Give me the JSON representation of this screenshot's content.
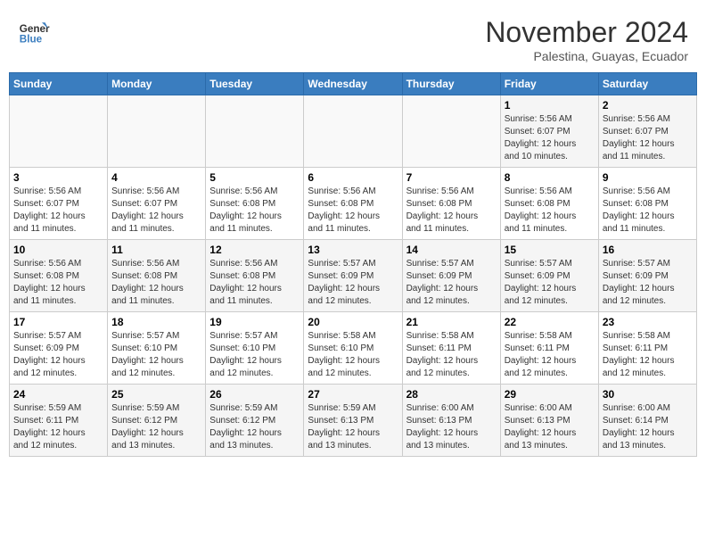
{
  "header": {
    "logo_line1": "General",
    "logo_line2": "Blue",
    "month": "November 2024",
    "location": "Palestina, Guayas, Ecuador"
  },
  "weekdays": [
    "Sunday",
    "Monday",
    "Tuesday",
    "Wednesday",
    "Thursday",
    "Friday",
    "Saturday"
  ],
  "weeks": [
    [
      {
        "day": "",
        "info": ""
      },
      {
        "day": "",
        "info": ""
      },
      {
        "day": "",
        "info": ""
      },
      {
        "day": "",
        "info": ""
      },
      {
        "day": "",
        "info": ""
      },
      {
        "day": "1",
        "info": "Sunrise: 5:56 AM\nSunset: 6:07 PM\nDaylight: 12 hours\nand 10 minutes."
      },
      {
        "day": "2",
        "info": "Sunrise: 5:56 AM\nSunset: 6:07 PM\nDaylight: 12 hours\nand 11 minutes."
      }
    ],
    [
      {
        "day": "3",
        "info": "Sunrise: 5:56 AM\nSunset: 6:07 PM\nDaylight: 12 hours\nand 11 minutes."
      },
      {
        "day": "4",
        "info": "Sunrise: 5:56 AM\nSunset: 6:07 PM\nDaylight: 12 hours\nand 11 minutes."
      },
      {
        "day": "5",
        "info": "Sunrise: 5:56 AM\nSunset: 6:08 PM\nDaylight: 12 hours\nand 11 minutes."
      },
      {
        "day": "6",
        "info": "Sunrise: 5:56 AM\nSunset: 6:08 PM\nDaylight: 12 hours\nand 11 minutes."
      },
      {
        "day": "7",
        "info": "Sunrise: 5:56 AM\nSunset: 6:08 PM\nDaylight: 12 hours\nand 11 minutes."
      },
      {
        "day": "8",
        "info": "Sunrise: 5:56 AM\nSunset: 6:08 PM\nDaylight: 12 hours\nand 11 minutes."
      },
      {
        "day": "9",
        "info": "Sunrise: 5:56 AM\nSunset: 6:08 PM\nDaylight: 12 hours\nand 11 minutes."
      }
    ],
    [
      {
        "day": "10",
        "info": "Sunrise: 5:56 AM\nSunset: 6:08 PM\nDaylight: 12 hours\nand 11 minutes."
      },
      {
        "day": "11",
        "info": "Sunrise: 5:56 AM\nSunset: 6:08 PM\nDaylight: 12 hours\nand 11 minutes."
      },
      {
        "day": "12",
        "info": "Sunrise: 5:56 AM\nSunset: 6:08 PM\nDaylight: 12 hours\nand 11 minutes."
      },
      {
        "day": "13",
        "info": "Sunrise: 5:57 AM\nSunset: 6:09 PM\nDaylight: 12 hours\nand 12 minutes."
      },
      {
        "day": "14",
        "info": "Sunrise: 5:57 AM\nSunset: 6:09 PM\nDaylight: 12 hours\nand 12 minutes."
      },
      {
        "day": "15",
        "info": "Sunrise: 5:57 AM\nSunset: 6:09 PM\nDaylight: 12 hours\nand 12 minutes."
      },
      {
        "day": "16",
        "info": "Sunrise: 5:57 AM\nSunset: 6:09 PM\nDaylight: 12 hours\nand 12 minutes."
      }
    ],
    [
      {
        "day": "17",
        "info": "Sunrise: 5:57 AM\nSunset: 6:09 PM\nDaylight: 12 hours\nand 12 minutes."
      },
      {
        "day": "18",
        "info": "Sunrise: 5:57 AM\nSunset: 6:10 PM\nDaylight: 12 hours\nand 12 minutes."
      },
      {
        "day": "19",
        "info": "Sunrise: 5:57 AM\nSunset: 6:10 PM\nDaylight: 12 hours\nand 12 minutes."
      },
      {
        "day": "20",
        "info": "Sunrise: 5:58 AM\nSunset: 6:10 PM\nDaylight: 12 hours\nand 12 minutes."
      },
      {
        "day": "21",
        "info": "Sunrise: 5:58 AM\nSunset: 6:11 PM\nDaylight: 12 hours\nand 12 minutes."
      },
      {
        "day": "22",
        "info": "Sunrise: 5:58 AM\nSunset: 6:11 PM\nDaylight: 12 hours\nand 12 minutes."
      },
      {
        "day": "23",
        "info": "Sunrise: 5:58 AM\nSunset: 6:11 PM\nDaylight: 12 hours\nand 12 minutes."
      }
    ],
    [
      {
        "day": "24",
        "info": "Sunrise: 5:59 AM\nSunset: 6:11 PM\nDaylight: 12 hours\nand 12 minutes."
      },
      {
        "day": "25",
        "info": "Sunrise: 5:59 AM\nSunset: 6:12 PM\nDaylight: 12 hours\nand 13 minutes."
      },
      {
        "day": "26",
        "info": "Sunrise: 5:59 AM\nSunset: 6:12 PM\nDaylight: 12 hours\nand 13 minutes."
      },
      {
        "day": "27",
        "info": "Sunrise: 5:59 AM\nSunset: 6:13 PM\nDaylight: 12 hours\nand 13 minutes."
      },
      {
        "day": "28",
        "info": "Sunrise: 6:00 AM\nSunset: 6:13 PM\nDaylight: 12 hours\nand 13 minutes."
      },
      {
        "day": "29",
        "info": "Sunrise: 6:00 AM\nSunset: 6:13 PM\nDaylight: 12 hours\nand 13 minutes."
      },
      {
        "day": "30",
        "info": "Sunrise: 6:00 AM\nSunset: 6:14 PM\nDaylight: 12 hours\nand 13 minutes."
      }
    ]
  ]
}
